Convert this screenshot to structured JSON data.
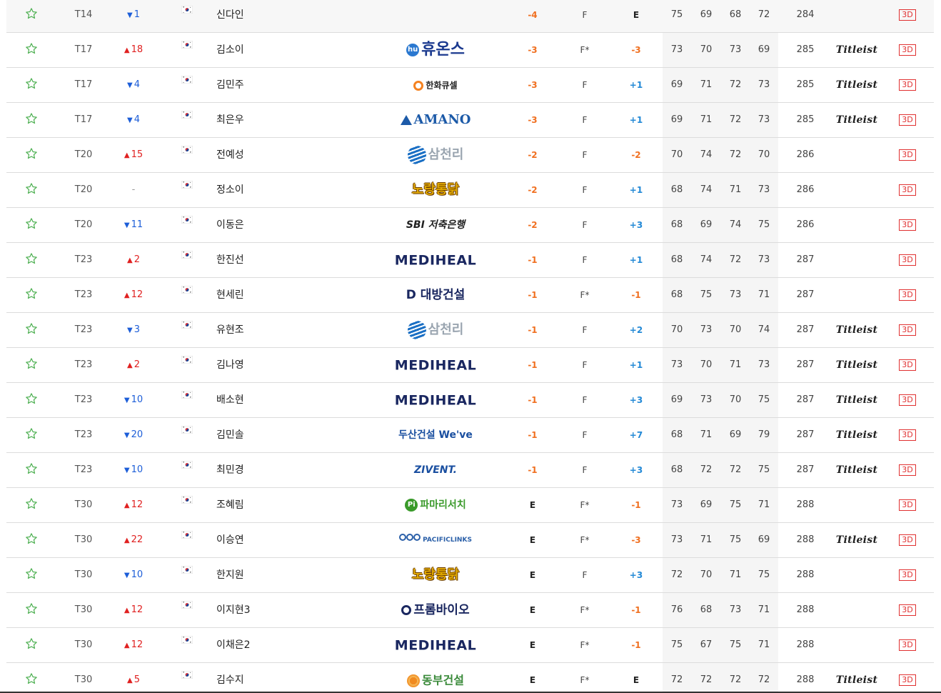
{
  "colors": {
    "star": "#4caf50",
    "up": "#e02020",
    "down": "#1d5ed8",
    "under_par": "#f07021",
    "over_par": "#2389d6",
    "threed_border": "#e03030"
  },
  "icons": {
    "favorite": "star-outline-icon",
    "flag": "korea-flag-icon",
    "move_up": "triangle-up-icon",
    "move_down": "triangle-down-icon"
  },
  "threed_label": "3D",
  "rows": [
    {
      "rank": "T14",
      "dir": "down",
      "move": "1",
      "name": "신다인",
      "sponsor": "",
      "sponsor_style": "none",
      "par": "-4",
      "par_cls": "under",
      "thru": "F",
      "today": "E",
      "today_cls": "even",
      "r1": "75",
      "r2": "69",
      "r3": "68",
      "r4": "72",
      "total": "284",
      "equipment": ""
    },
    {
      "rank": "T17",
      "dir": "up",
      "move": "18",
      "name": "김소이",
      "sponsor": "휴온스",
      "sponsor_style": "huons",
      "par": "-3",
      "par_cls": "under",
      "thru": "F*",
      "today": "-3",
      "today_cls": "under",
      "r1": "73",
      "r2": "70",
      "r3": "73",
      "r4": "69",
      "total": "285",
      "equipment": "Titleist"
    },
    {
      "rank": "T17",
      "dir": "down",
      "move": "4",
      "name": "김민주",
      "sponsor": "한화큐셀",
      "sponsor_style": "hanwha",
      "par": "-3",
      "par_cls": "under",
      "thru": "F",
      "today": "+1",
      "today_cls": "over",
      "r1": "69",
      "r2": "71",
      "r3": "72",
      "r4": "73",
      "total": "285",
      "equipment": "Titleist"
    },
    {
      "rank": "T17",
      "dir": "down",
      "move": "4",
      "name": "최은우",
      "sponsor": "AMANO",
      "sponsor_style": "amano",
      "par": "-3",
      "par_cls": "under",
      "thru": "F",
      "today": "+1",
      "today_cls": "over",
      "r1": "69",
      "r2": "71",
      "r3": "72",
      "r4": "73",
      "total": "285",
      "equipment": "Titleist"
    },
    {
      "rank": "T20",
      "dir": "up",
      "move": "15",
      "name": "전예성",
      "sponsor": "삼천리",
      "sponsor_style": "samchully",
      "par": "-2",
      "par_cls": "under",
      "thru": "F",
      "today": "-2",
      "today_cls": "under",
      "r1": "70",
      "r2": "74",
      "r3": "72",
      "r4": "70",
      "total": "286",
      "equipment": ""
    },
    {
      "rank": "T20",
      "dir": "same",
      "move": "-",
      "name": "정소이",
      "sponsor": "노랑통닭",
      "sponsor_style": "norang",
      "par": "-2",
      "par_cls": "under",
      "thru": "F",
      "today": "+1",
      "today_cls": "over",
      "r1": "68",
      "r2": "74",
      "r3": "71",
      "r4": "73",
      "total": "286",
      "equipment": ""
    },
    {
      "rank": "T20",
      "dir": "down",
      "move": "11",
      "name": "이동은",
      "sponsor": "SBI 저축은행",
      "sponsor_style": "sbi",
      "par": "-2",
      "par_cls": "under",
      "thru": "F",
      "today": "+3",
      "today_cls": "over",
      "r1": "68",
      "r2": "69",
      "r3": "74",
      "r4": "75",
      "total": "286",
      "equipment": ""
    },
    {
      "rank": "T23",
      "dir": "up",
      "move": "2",
      "name": "한진선",
      "sponsor": "MEDIHEAL",
      "sponsor_style": "mediheal",
      "par": "-1",
      "par_cls": "under",
      "thru": "F",
      "today": "+1",
      "today_cls": "over",
      "r1": "68",
      "r2": "74",
      "r3": "72",
      "r4": "73",
      "total": "287",
      "equipment": ""
    },
    {
      "rank": "T23",
      "dir": "up",
      "move": "12",
      "name": "현세린",
      "sponsor": "D 대방건설",
      "sponsor_style": "daebang",
      "par": "-1",
      "par_cls": "under",
      "thru": "F*",
      "today": "-1",
      "today_cls": "under",
      "r1": "68",
      "r2": "75",
      "r3": "73",
      "r4": "71",
      "total": "287",
      "equipment": ""
    },
    {
      "rank": "T23",
      "dir": "down",
      "move": "3",
      "name": "유현조",
      "sponsor": "삼천리",
      "sponsor_style": "samchully",
      "par": "-1",
      "par_cls": "under",
      "thru": "F",
      "today": "+2",
      "today_cls": "over",
      "r1": "70",
      "r2": "73",
      "r3": "70",
      "r4": "74",
      "total": "287",
      "equipment": "Titleist"
    },
    {
      "rank": "T23",
      "dir": "up",
      "move": "2",
      "name": "김나영",
      "sponsor": "MEDIHEAL",
      "sponsor_style": "mediheal",
      "par": "-1",
      "par_cls": "under",
      "thru": "F",
      "today": "+1",
      "today_cls": "over",
      "r1": "73",
      "r2": "70",
      "r3": "71",
      "r4": "73",
      "total": "287",
      "equipment": "Titleist"
    },
    {
      "rank": "T23",
      "dir": "down",
      "move": "10",
      "name": "배소현",
      "sponsor": "MEDIHEAL",
      "sponsor_style": "mediheal",
      "par": "-1",
      "par_cls": "under",
      "thru": "F",
      "today": "+3",
      "today_cls": "over",
      "r1": "69",
      "r2": "73",
      "r3": "70",
      "r4": "75",
      "total": "287",
      "equipment": "Titleist"
    },
    {
      "rank": "T23",
      "dir": "down",
      "move": "20",
      "name": "김민솔",
      "sponsor": "두산건설 We've",
      "sponsor_style": "doosan",
      "par": "-1",
      "par_cls": "under",
      "thru": "F",
      "today": "+7",
      "today_cls": "over",
      "r1": "68",
      "r2": "71",
      "r3": "69",
      "r4": "79",
      "total": "287",
      "equipment": "Titleist"
    },
    {
      "rank": "T23",
      "dir": "down",
      "move": "10",
      "name": "최민경",
      "sponsor": "ZIVENT.",
      "sponsor_style": "zivent",
      "par": "-1",
      "par_cls": "under",
      "thru": "F",
      "today": "+3",
      "today_cls": "over",
      "r1": "68",
      "r2": "72",
      "r3": "72",
      "r4": "75",
      "total": "287",
      "equipment": "Titleist"
    },
    {
      "rank": "T30",
      "dir": "up",
      "move": "12",
      "name": "조혜림",
      "sponsor": "파마리서치",
      "sponsor_style": "pharma",
      "par": "E",
      "par_cls": "even",
      "thru": "F*",
      "today": "-1",
      "today_cls": "under",
      "r1": "73",
      "r2": "69",
      "r3": "75",
      "r4": "71",
      "total": "288",
      "equipment": ""
    },
    {
      "rank": "T30",
      "dir": "up",
      "move": "22",
      "name": "이승연",
      "sponsor": "PACIFICLINKS",
      "sponsor_style": "pacific",
      "par": "E",
      "par_cls": "even",
      "thru": "F*",
      "today": "-3",
      "today_cls": "under",
      "r1": "73",
      "r2": "71",
      "r3": "75",
      "r4": "69",
      "total": "288",
      "equipment": "Titleist"
    },
    {
      "rank": "T30",
      "dir": "down",
      "move": "10",
      "name": "한지원",
      "sponsor": "노랑통닭",
      "sponsor_style": "norang",
      "par": "E",
      "par_cls": "even",
      "thru": "F",
      "today": "+3",
      "today_cls": "over",
      "r1": "72",
      "r2": "70",
      "r3": "71",
      "r4": "75",
      "total": "288",
      "equipment": ""
    },
    {
      "rank": "T30",
      "dir": "up",
      "move": "12",
      "name": "이지현3",
      "sponsor": "프롬바이오",
      "sponsor_style": "frombio",
      "par": "E",
      "par_cls": "even",
      "thru": "F*",
      "today": "-1",
      "today_cls": "under",
      "r1": "76",
      "r2": "68",
      "r3": "73",
      "r4": "71",
      "total": "288",
      "equipment": ""
    },
    {
      "rank": "T30",
      "dir": "up",
      "move": "12",
      "name": "이채은2",
      "sponsor": "MEDIHEAL",
      "sponsor_style": "mediheal",
      "par": "E",
      "par_cls": "even",
      "thru": "F*",
      "today": "-1",
      "today_cls": "under",
      "r1": "75",
      "r2": "67",
      "r3": "75",
      "r4": "71",
      "total": "288",
      "equipment": ""
    },
    {
      "rank": "T30",
      "dir": "up",
      "move": "5",
      "name": "김수지",
      "sponsor": "동부건설",
      "sponsor_style": "dongbu",
      "par": "E",
      "par_cls": "even",
      "thru": "F*",
      "today": "E",
      "today_cls": "even",
      "r1": "72",
      "r2": "72",
      "r3": "72",
      "r4": "72",
      "total": "288",
      "equipment": "Titleist"
    }
  ]
}
